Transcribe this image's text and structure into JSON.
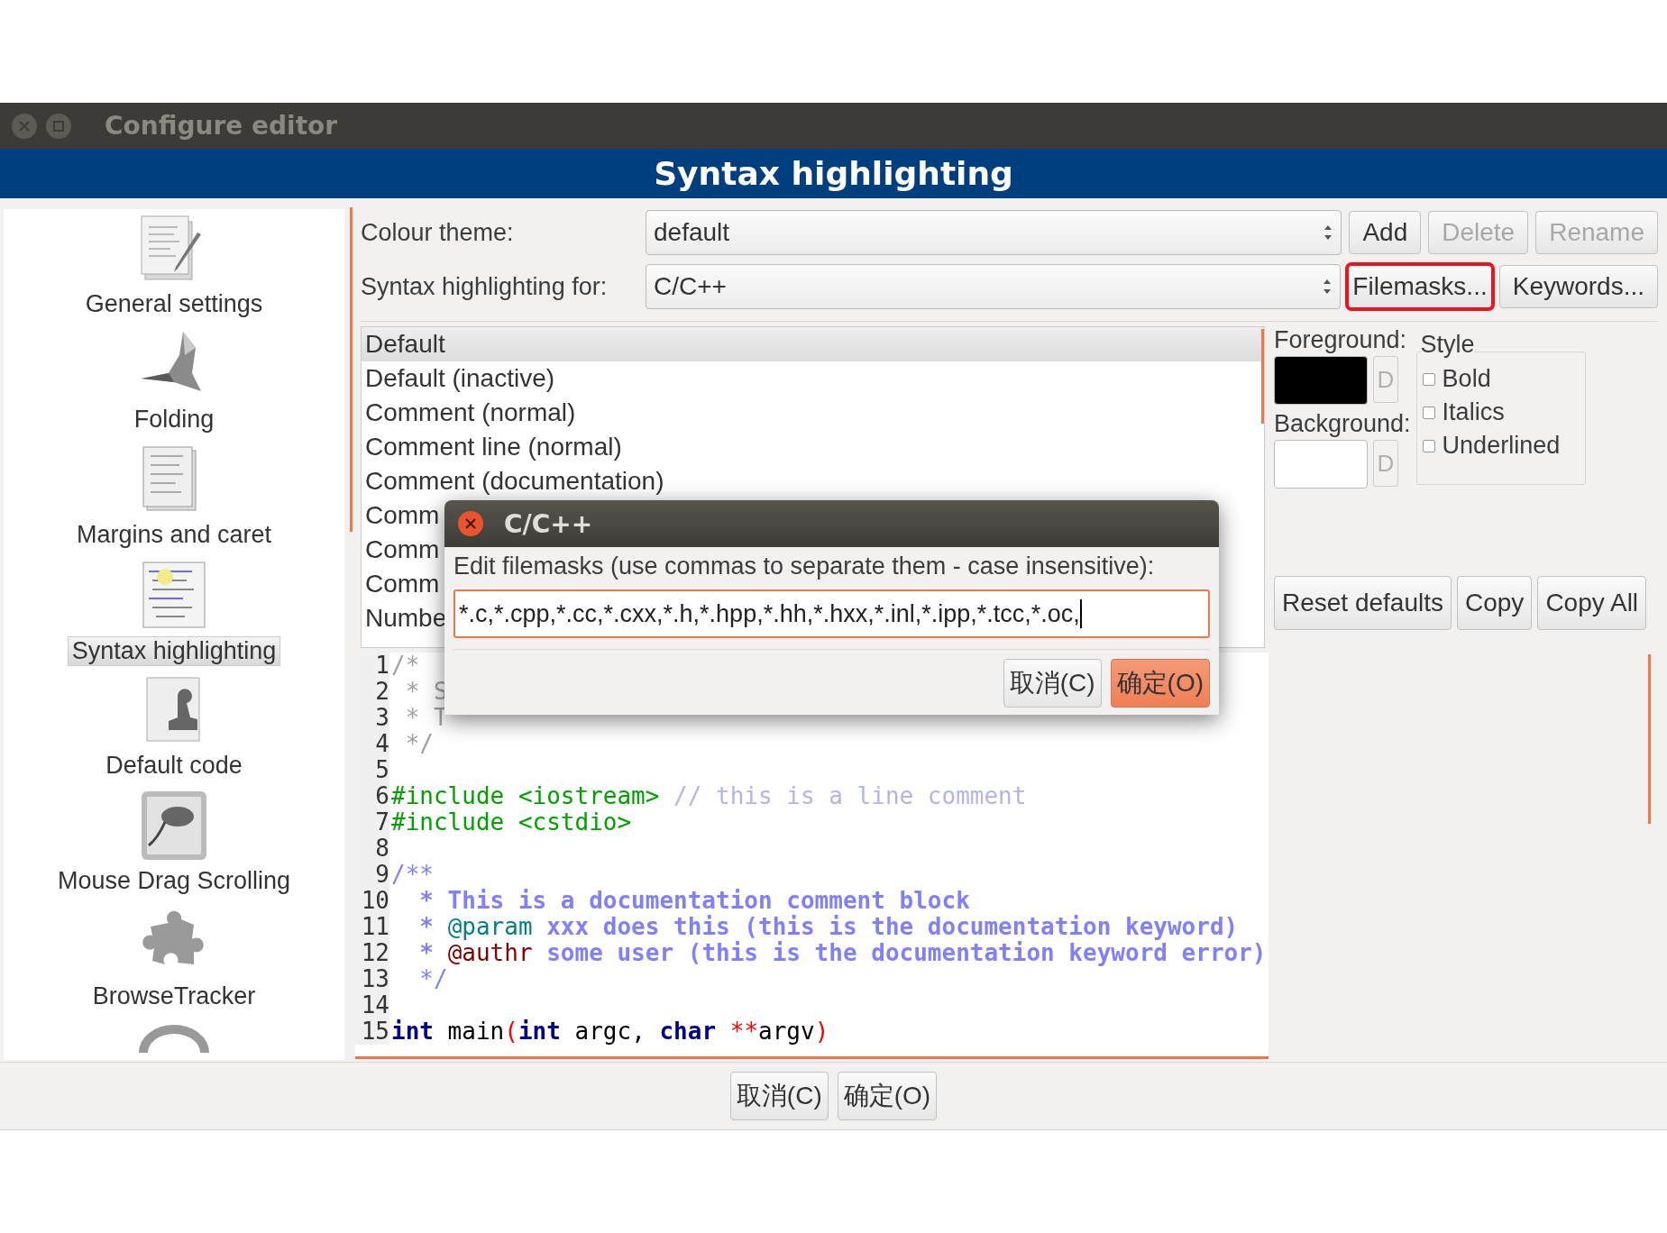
{
  "window": {
    "title": "Configure editor"
  },
  "banner": {
    "title": "Syntax highlighting"
  },
  "sidebar": {
    "items": [
      {
        "label": "General settings",
        "selected": false
      },
      {
        "label": "Folding",
        "selected": false
      },
      {
        "label": "Margins and caret",
        "selected": false
      },
      {
        "label": "Syntax highlighting",
        "selected": true
      },
      {
        "label": "Default code",
        "selected": false
      },
      {
        "label": "Mouse Drag Scrolling",
        "selected": false
      },
      {
        "label": "BrowseTracker",
        "selected": false
      }
    ]
  },
  "colour_theme": {
    "label": "Colour theme:",
    "value": "default",
    "buttons": [
      {
        "label": "Add",
        "disabled": false
      },
      {
        "label": "Delete",
        "disabled": true
      },
      {
        "label": "Rename",
        "disabled": true
      }
    ]
  },
  "syntax_for": {
    "label": "Syntax highlighting for:",
    "value": "C/C++",
    "buttons": [
      {
        "label": "Filemasks...",
        "annotated": true
      },
      {
        "label": "Keywords...",
        "annotated": false
      }
    ]
  },
  "styles": {
    "items": [
      {
        "label": "Default",
        "selected": true
      },
      {
        "label": "Default (inactive)",
        "selected": false
      },
      {
        "label": "Comment (normal)",
        "selected": false
      },
      {
        "label": "Comment line (normal)",
        "selected": false
      },
      {
        "label": "Comment (documentation)",
        "selected": false
      },
      {
        "label": "Comm",
        "selected": false
      },
      {
        "label": "Comm",
        "selected": false
      },
      {
        "label": "Comm",
        "selected": false
      },
      {
        "label": "Numbe",
        "selected": false
      }
    ]
  },
  "foreground": {
    "label": "Foreground:",
    "color": "#000000",
    "default_button": {
      "label": "D",
      "disabled": true
    }
  },
  "background": {
    "label": "Background:",
    "color": "#ffffff",
    "default_button": {
      "label": "D",
      "disabled": true
    }
  },
  "style_box": {
    "title": "Style",
    "options": [
      {
        "label": "Bold",
        "checked": false
      },
      {
        "label": "Italics",
        "checked": false
      },
      {
        "label": "Underlined",
        "checked": false
      }
    ]
  },
  "actions": [
    "Reset defaults",
    "Copy",
    "Copy All"
  ],
  "editor": {
    "lines": [
      {
        "number": "1",
        "tokens": [
          {
            "kind": "comment",
            "text": "/*"
          }
        ]
      },
      {
        "number": "2",
        "tokens": [
          {
            "kind": "comment",
            "text": " * S"
          }
        ]
      },
      {
        "number": "3",
        "tokens": [
          {
            "kind": "comment",
            "text": " * T"
          }
        ]
      },
      {
        "number": "4",
        "tokens": [
          {
            "kind": "comment",
            "text": " */"
          }
        ]
      },
      {
        "number": "5"
      },
      {
        "number": "6",
        "tokens": [
          {
            "kind": "preprocessor",
            "text": "#include <iostream>"
          },
          {
            "kind": "line_comment",
            "text": " // this is a line comment"
          }
        ]
      },
      {
        "number": "7",
        "tokens": [
          {
            "kind": "preprocessor",
            "text": "#include <cstdio>"
          }
        ]
      },
      {
        "number": "8"
      },
      {
        "number": "9",
        "tokens": [
          {
            "kind": "doc_delim",
            "text": "/**"
          }
        ]
      },
      {
        "number": "10",
        "tokens": [
          {
            "kind": "doc",
            "text": "  * This is a documentation comment block"
          }
        ]
      },
      {
        "number": "11",
        "tokens": [
          {
            "kind": "doc",
            "text": "  * "
          },
          {
            "kind": "doc_keyword",
            "text": "@param"
          },
          {
            "kind": "doc",
            "text": " xxx does this (this is the documentation keyword)"
          }
        ]
      },
      {
        "number": "12",
        "tokens": [
          {
            "kind": "doc",
            "text": "  * "
          },
          {
            "kind": "doc_error",
            "text": "@authr"
          },
          {
            "kind": "doc",
            "text": " some user (this is the documentation keyword error)"
          }
        ]
      },
      {
        "number": "13",
        "tokens": [
          {
            "kind": "doc_delim",
            "text": "  */"
          }
        ]
      },
      {
        "number": "14"
      },
      {
        "number": "15",
        "tokens": [
          {
            "kind": "keyword",
            "text": "int"
          },
          {
            "kind": "plain",
            "text": " main"
          },
          {
            "kind": "operator",
            "text": "("
          },
          {
            "kind": "keyword",
            "text": "int"
          },
          {
            "kind": "plain",
            "text": " argc, "
          },
          {
            "kind": "keyword",
            "text": "char"
          },
          {
            "kind": "operator",
            "text": " **"
          },
          {
            "kind": "plain",
            "text": "argv"
          },
          {
            "kind": "operator",
            "text": ")"
          }
        ]
      }
    ]
  },
  "dialog": {
    "title": "C/C++",
    "prompt": "Edit filemasks (use commas to separate them - case insensitive):",
    "value": "*.c,*.cpp,*.cc,*.cxx,*.h,*.hpp,*.hh,*.hxx,*.inl,*.ipp,*.tcc,*.oc,",
    "buttons": [
      {
        "label": "取消(C)",
        "default": false
      },
      {
        "label": "确定(O)",
        "default": true
      }
    ]
  },
  "footer_buttons": [
    "取消(C)",
    "确定(O)"
  ]
}
